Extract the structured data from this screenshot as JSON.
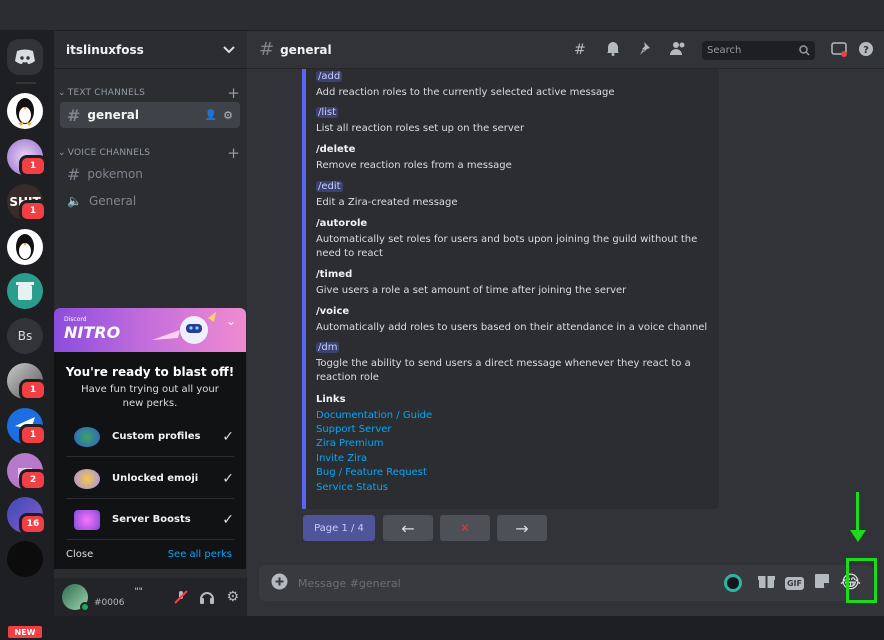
{
  "server": {
    "name": "itslinuxfoss"
  },
  "guilds": [
    {
      "label": "",
      "badge": ""
    },
    {
      "label": "",
      "badge": ""
    },
    {
      "label": "",
      "badge": "1"
    },
    {
      "label": "SHIT",
      "badge": "1"
    },
    {
      "label": "",
      "badge": ""
    },
    {
      "label": "",
      "badge": ""
    },
    {
      "label": "Bs",
      "badge": ""
    },
    {
      "label": "",
      "badge": "1"
    },
    {
      "label": "",
      "badge": "1"
    },
    {
      "label": "",
      "badge": "2"
    },
    {
      "label": "",
      "badge": "16"
    },
    {
      "label": "",
      "badge": ""
    }
  ],
  "new_badge": "NEW",
  "categories": {
    "text": "TEXT CHANNELS",
    "voice": "VOICE CHANNELS"
  },
  "channels": {
    "general": "general",
    "pokemon": "pokemon",
    "voice_general": "General"
  },
  "nitro": {
    "brand_small": "Discord",
    "brand": "NITRO",
    "heading": "You're ready to blast off!",
    "sub": "Have fun trying out all your new perks.",
    "perks": [
      "Custom profiles",
      "Unlocked emoji",
      "Server Boosts"
    ],
    "close": "Close",
    "see_all": "See all perks"
  },
  "user": {
    "tag": "#0006",
    "status": "\"\""
  },
  "header": {
    "channel": "general",
    "search_placeholder": "Search"
  },
  "embed": {
    "commands": [
      {
        "name": "/add",
        "desc": "Add reaction roles to the currently selected active message",
        "highlight": true
      },
      {
        "name": "/list",
        "desc": "List all reaction roles set up on the server",
        "highlight": true
      },
      {
        "name": "/delete",
        "desc": "Remove reaction roles from a message",
        "highlight": false
      },
      {
        "name": "/edit",
        "desc": "Edit a Zira-created message",
        "highlight": true
      },
      {
        "name": "/autorole",
        "desc": "Automatically set roles for users and bots upon joining the guild without the need to react",
        "highlight": false
      },
      {
        "name": "/timed",
        "desc": "Give users a role a set amount of time after joining the server",
        "highlight": false
      },
      {
        "name": "/voice",
        "desc": "Automatically add roles to users based on their attendance in a voice channel",
        "highlight": false
      },
      {
        "name": "/dm",
        "desc": "Toggle the ability to send users a direct message whenever they react to a reaction role",
        "highlight": true
      }
    ],
    "links_title": "Links",
    "links": [
      "Documentation / Guide",
      "Support Server",
      "Zira Premium",
      "Invite Zira",
      "Bug / Feature Request",
      "Service Status"
    ]
  },
  "pagination": {
    "page": "Page 1 / 4",
    "prev": "←",
    "stop": "✕",
    "next": "→"
  },
  "composer": {
    "placeholder": "Message #general",
    "gif": "GIF",
    "emoji": "😂"
  },
  "colors": {
    "accent": "#5865f2",
    "highlight": "#1adc1a",
    "link": "#00a8fc"
  }
}
